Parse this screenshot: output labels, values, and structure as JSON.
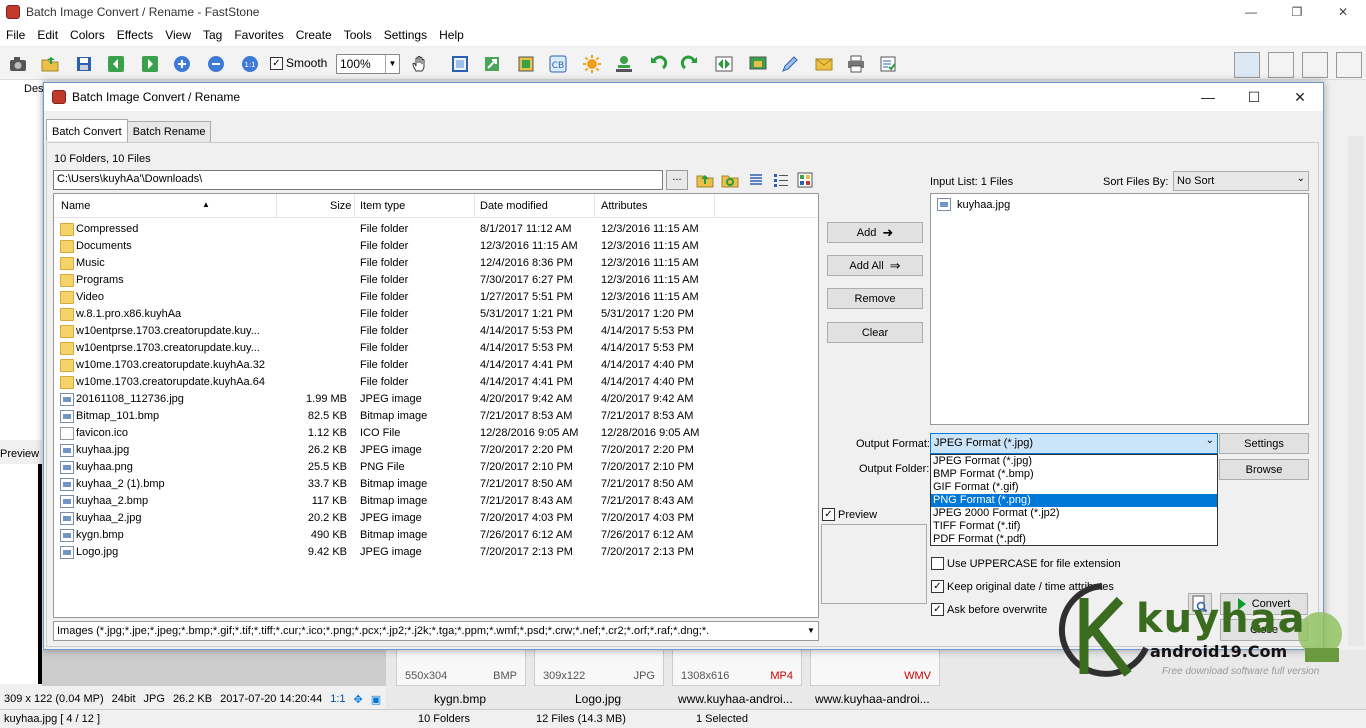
{
  "app": {
    "title": "Batch Image Convert / Rename - FastStone"
  },
  "menu": [
    "File",
    "Edit",
    "Colors",
    "Effects",
    "View",
    "Tag",
    "Favorites",
    "Create",
    "Tools",
    "Settings",
    "Help"
  ],
  "toolbar": {
    "smooth_label": "Smooth",
    "smooth_checked": true,
    "zoom_value": "100%"
  },
  "tree": {
    "first_label": "Des"
  },
  "background": {
    "preview_label": "Preview",
    "image_info": {
      "dims": "309 x 122 (0.04 MP)",
      "depth": "24bit",
      "format": "JPG",
      "size": "26.2 KB",
      "datetime": "2017-07-20 14:20:44",
      "zoom": "1:1"
    },
    "thumbnails": [
      {
        "dims": "550x304",
        "format": "BMP",
        "name": "kygn.bmp"
      },
      {
        "dims": "309x122",
        "format": "JPG",
        "name": "Logo.jpg"
      },
      {
        "dims": "1308x616",
        "format": "MP4",
        "name": "www.kuyhaa-androi..."
      },
      {
        "dims": "",
        "format": "WMV",
        "name": "www.kuyhaa-androi..."
      }
    ]
  },
  "status": {
    "file": "kuyhaa.jpg [ 4 / 12 ]",
    "folders": "10 Folders",
    "files": "12 Files (14.3 MB)",
    "selected": "1 Selected"
  },
  "dialog": {
    "title": "Batch Image Convert / Rename",
    "tabs": [
      "Batch Convert",
      "Batch Rename"
    ],
    "folder_count": "10 Folders, 10 Files",
    "path": "C:\\Users\\kuyhAa'\\Downloads\\",
    "dots": "...",
    "columns": [
      "Name",
      "Size",
      "Item type",
      "Date modified",
      "Attributes"
    ],
    "files": [
      {
        "name": "Compressed",
        "size": "",
        "type": "File folder",
        "modified": "8/1/2017 11:12 AM",
        "attr": "12/3/2016 11:15 AM",
        "kind": "folder"
      },
      {
        "name": "Documents",
        "size": "",
        "type": "File folder",
        "modified": "12/3/2016 11:15 AM",
        "attr": "12/3/2016 11:15 AM",
        "kind": "folder"
      },
      {
        "name": "Music",
        "size": "",
        "type": "File folder",
        "modified": "12/4/2016 8:36 PM",
        "attr": "12/3/2016 11:15 AM",
        "kind": "folder"
      },
      {
        "name": "Programs",
        "size": "",
        "type": "File folder",
        "modified": "7/30/2017 6:27 PM",
        "attr": "12/3/2016 11:15 AM",
        "kind": "folder"
      },
      {
        "name": "Video",
        "size": "",
        "type": "File folder",
        "modified": "1/27/2017 5:51 PM",
        "attr": "12/3/2016 11:15 AM",
        "kind": "folder"
      },
      {
        "name": "w.8.1.pro.x86.kuyhAa",
        "size": "",
        "type": "File folder",
        "modified": "5/31/2017 1:21 PM",
        "attr": "5/31/2017 1:20 PM",
        "kind": "folder"
      },
      {
        "name": "w10entprse.1703.creatorupdate.kuy...",
        "size": "",
        "type": "File folder",
        "modified": "4/14/2017 5:53 PM",
        "attr": "4/14/2017 5:53 PM",
        "kind": "folder"
      },
      {
        "name": "w10entprse.1703.creatorupdate.kuy...",
        "size": "",
        "type": "File folder",
        "modified": "4/14/2017 5:53 PM",
        "attr": "4/14/2017 5:53 PM",
        "kind": "folder"
      },
      {
        "name": "w10me.1703.creatorupdate.kuyhAa.32",
        "size": "",
        "type": "File folder",
        "modified": "4/14/2017 4:41 PM",
        "attr": "4/14/2017 4:40 PM",
        "kind": "folder"
      },
      {
        "name": "w10me.1703.creatorupdate.kuyhAa.64",
        "size": "",
        "type": "File folder",
        "modified": "4/14/2017 4:41 PM",
        "attr": "4/14/2017 4:40 PM",
        "kind": "folder"
      },
      {
        "name": "20161108_112736.jpg",
        "size": "1.99 MB",
        "type": "JPEG image",
        "modified": "4/20/2017 9:42 AM",
        "attr": "4/20/2017 9:42 AM",
        "kind": "img"
      },
      {
        "name": "Bitmap_101.bmp",
        "size": "82.5 KB",
        "type": "Bitmap image",
        "modified": "7/21/2017 8:53 AM",
        "attr": "7/21/2017 8:53 AM",
        "kind": "img"
      },
      {
        "name": "favicon.ico",
        "size": "1.12 KB",
        "type": "ICO File",
        "modified": "12/28/2016 9:05 AM",
        "attr": "12/28/2016 9:05 AM",
        "kind": "doc"
      },
      {
        "name": "kuyhaa.jpg",
        "size": "26.2 KB",
        "type": "JPEG image",
        "modified": "7/20/2017 2:20 PM",
        "attr": "7/20/2017 2:20 PM",
        "kind": "img"
      },
      {
        "name": "kuyhaa.png",
        "size": "25.5 KB",
        "type": "PNG File",
        "modified": "7/20/2017 2:10 PM",
        "attr": "7/20/2017 2:10 PM",
        "kind": "img"
      },
      {
        "name": "kuyhaa_2 (1).bmp",
        "size": "33.7 KB",
        "type": "Bitmap image",
        "modified": "7/21/2017 8:50 AM",
        "attr": "7/21/2017 8:50 AM",
        "kind": "img"
      },
      {
        "name": "kuyhaa_2.bmp",
        "size": "117 KB",
        "type": "Bitmap image",
        "modified": "7/21/2017 8:43 AM",
        "attr": "7/21/2017 8:43 AM",
        "kind": "img"
      },
      {
        "name": "kuyhaa_2.jpg",
        "size": "20.2 KB",
        "type": "JPEG image",
        "modified": "7/20/2017 4:03 PM",
        "attr": "7/20/2017 4:03 PM",
        "kind": "img"
      },
      {
        "name": "kygn.bmp",
        "size": "490 KB",
        "type": "Bitmap image",
        "modified": "7/26/2017 6:12 AM",
        "attr": "7/26/2017 6:12 AM",
        "kind": "img"
      },
      {
        "name": "Logo.jpg",
        "size": "9.42 KB",
        "type": "JPEG image",
        "modified": "7/20/2017 2:13 PM",
        "attr": "7/20/2017 2:13 PM",
        "kind": "img"
      }
    ],
    "filter": "Images (*.jpg;*.jpe;*.jpeg;*.bmp;*.gif;*.tif;*.tiff;*.cur;*.ico;*.png;*.pcx;*.jp2;*.j2k;*.tga;*.ppm;*.wmf;*.psd;*.crw;*.nef;*.cr2;*.orf;*.raf;*.dng;*.",
    "buttons": {
      "add": "Add",
      "add_all": "Add All",
      "remove": "Remove",
      "clear": "Clear",
      "settings": "Settings",
      "browse": "Browse",
      "convert": "Convert",
      "close": "Close"
    },
    "input_list_label": "Input List:  1 Files",
    "input_files": [
      "kuyhaa.jpg"
    ],
    "sort_label": "Sort Files By:",
    "sort_value": "No Sort",
    "output_format_label": "Output Format:",
    "output_format_value": "JPEG Format (*.jpg)",
    "output_format_options": [
      "JPEG Format (*.jpg)",
      "BMP Format (*.bmp)",
      "GIF Format (*.gif)",
      "PNG Format (*.png)",
      "JPEG 2000 Format (*.jp2)",
      "TIFF Format (*.tif)",
      "PDF Format (*.pdf)"
    ],
    "output_format_highlighted": 3,
    "output_folder_label": "Output Folder:",
    "preview_label": "Preview",
    "preview_checked": true,
    "options": [
      {
        "label": "Use UPPERCASE for file extension",
        "checked": false
      },
      {
        "label": "Keep original date / time attributes",
        "checked": true
      },
      {
        "label": "Ask before overwrite",
        "checked": true
      }
    ]
  },
  "watermark": {
    "brand": "kuyhaa",
    "site": "android19.Com",
    "tagline": "Free download software full version"
  },
  "colors": {
    "accent": "#0078d7",
    "folder": "#f5d36b",
    "convert_green": "#0a9b2a",
    "watermark_green": "#3a6b1e"
  }
}
